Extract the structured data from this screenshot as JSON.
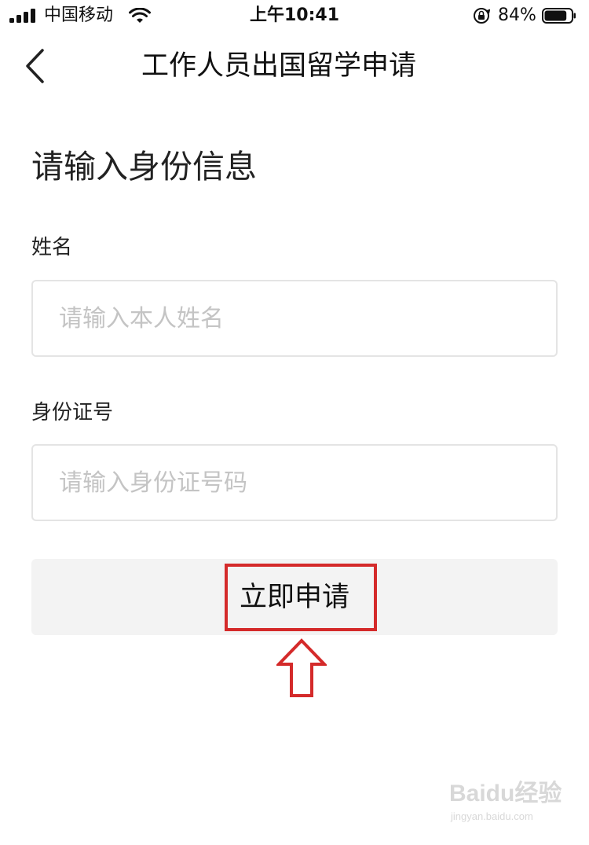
{
  "status_bar": {
    "carrier": "中国移动",
    "time": "上午10:41",
    "battery_percent": "84%",
    "battery_level": 0.84
  },
  "nav": {
    "title": "工作人员出国留学申请"
  },
  "form": {
    "heading": "请输入身份信息",
    "name": {
      "label": "姓名",
      "placeholder": "请输入本人姓名",
      "value": ""
    },
    "id_number": {
      "label": "身份证号",
      "placeholder": "请输入身份证号码",
      "value": ""
    },
    "submit_label": "立即申请"
  },
  "annotation": {
    "color": "#d42a2a"
  },
  "watermark": {
    "brand": "Baidu经验",
    "url": "jingyan.baidu.com"
  },
  "icons": {
    "back": "chevron-left-icon",
    "signal": "cellular-signal-icon",
    "wifi": "wifi-icon",
    "lock": "rotation-lock-icon",
    "battery": "battery-icon",
    "arrow": "arrow-up-icon"
  }
}
